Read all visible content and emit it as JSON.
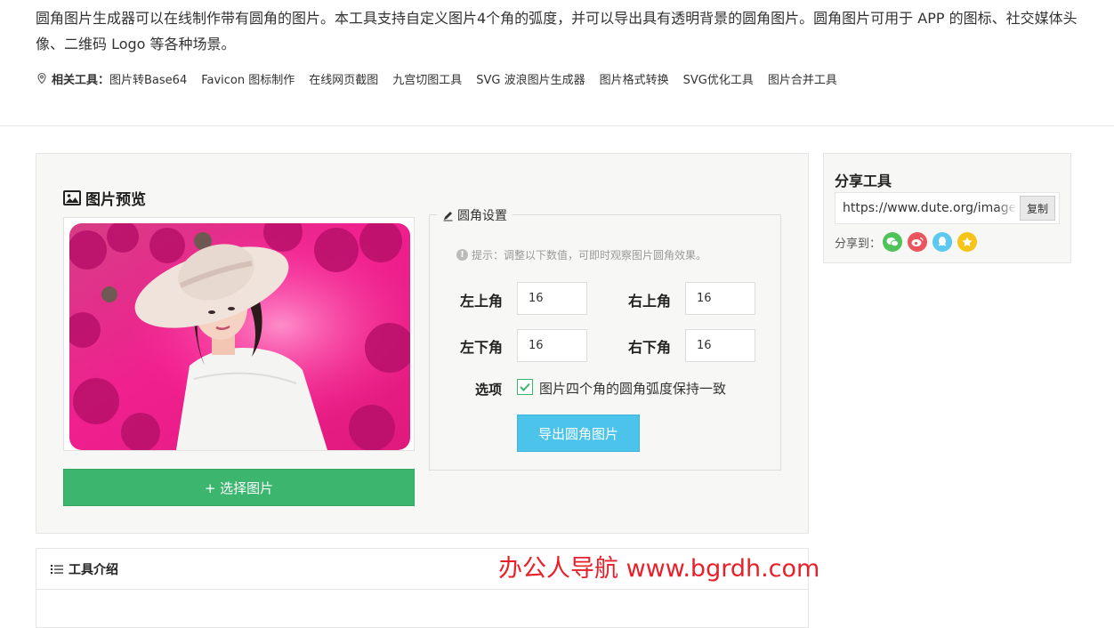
{
  "intro": {
    "text": "圆角图片生成器可以在线制作带有圆角的图片。本工具支持自定义图片4个角的弧度，并可以导出具有透明背景的圆角图片。圆角图片可用于 APP 的图标、社交媒体头像、二维码 Logo 等各种场景。"
  },
  "related": {
    "label": "相关工具：",
    "items": [
      "图片转Base64",
      "Favicon 图标制作",
      "在线网页截图",
      "九宫切图工具",
      "SVG 波浪图片生成器",
      "图片格式转换",
      "SVG优化工具",
      "图片合并工具"
    ]
  },
  "preview": {
    "title": "图片预览",
    "choose_button": "+ 选择图片"
  },
  "settings": {
    "legend": "圆角设置",
    "hint": "提示：调整以下数值，可即时观察图片圆角效果。",
    "top_left_label": "左上角",
    "top_left_value": "16",
    "top_right_label": "右上角",
    "top_right_value": "16",
    "bottom_left_label": "左下角",
    "bottom_left_value": "16",
    "bottom_right_label": "右下角",
    "bottom_right_value": "16",
    "option_label": "选项",
    "option_text": "图片四个角的圆角弧度保持一致",
    "option_checked": true,
    "export_button": "导出圆角图片"
  },
  "share": {
    "title": "分享工具",
    "url": "https://www.dute.org/image-rounded-corner",
    "copy_button": "复制",
    "share_to_label": "分享到：",
    "icons": [
      "wechat-icon",
      "weibo-icon",
      "qq-icon",
      "qzone-icon"
    ]
  },
  "tool_intro": {
    "title": "工具介绍"
  },
  "watermark": {
    "text": "办公人导航 www.bgrdh.com"
  },
  "colors": {
    "green": "#3cb56e",
    "blue": "#4cc3ea",
    "watermark_red": "#e8202a"
  }
}
